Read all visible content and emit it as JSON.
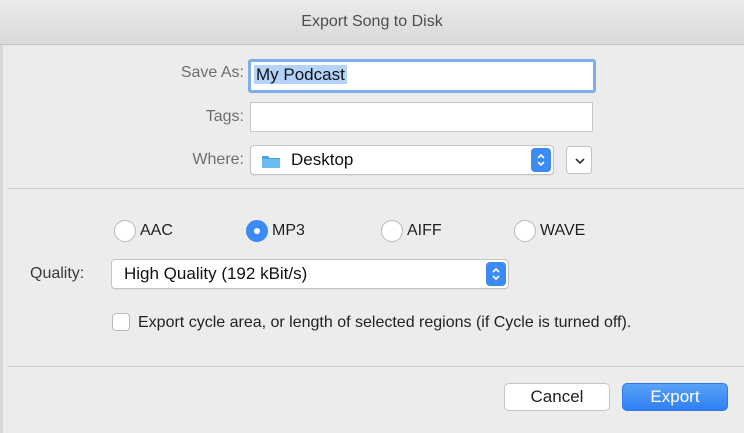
{
  "window": {
    "title": "Export Song to Disk"
  },
  "form": {
    "save_as_label": "Save As:",
    "save_as_value": "My Podcast",
    "tags_label": "Tags:",
    "tags_value": "",
    "where_label": "Where:",
    "where_value": "Desktop"
  },
  "format": {
    "options": [
      {
        "label": "AAC",
        "selected": false
      },
      {
        "label": "MP3",
        "selected": true
      },
      {
        "label": "AIFF",
        "selected": false
      },
      {
        "label": "WAVE",
        "selected": false
      }
    ],
    "quality_label": "Quality:",
    "quality_value": "High Quality (192 kBit/s)",
    "cycle_checkbox_label": "Export cycle area, or length of selected regions (if Cycle is turned off).",
    "cycle_checked": false
  },
  "buttons": {
    "cancel": "Cancel",
    "export": "Export"
  },
  "colors": {
    "accent": "#3b8af5",
    "folder": "#4aa3e8"
  }
}
